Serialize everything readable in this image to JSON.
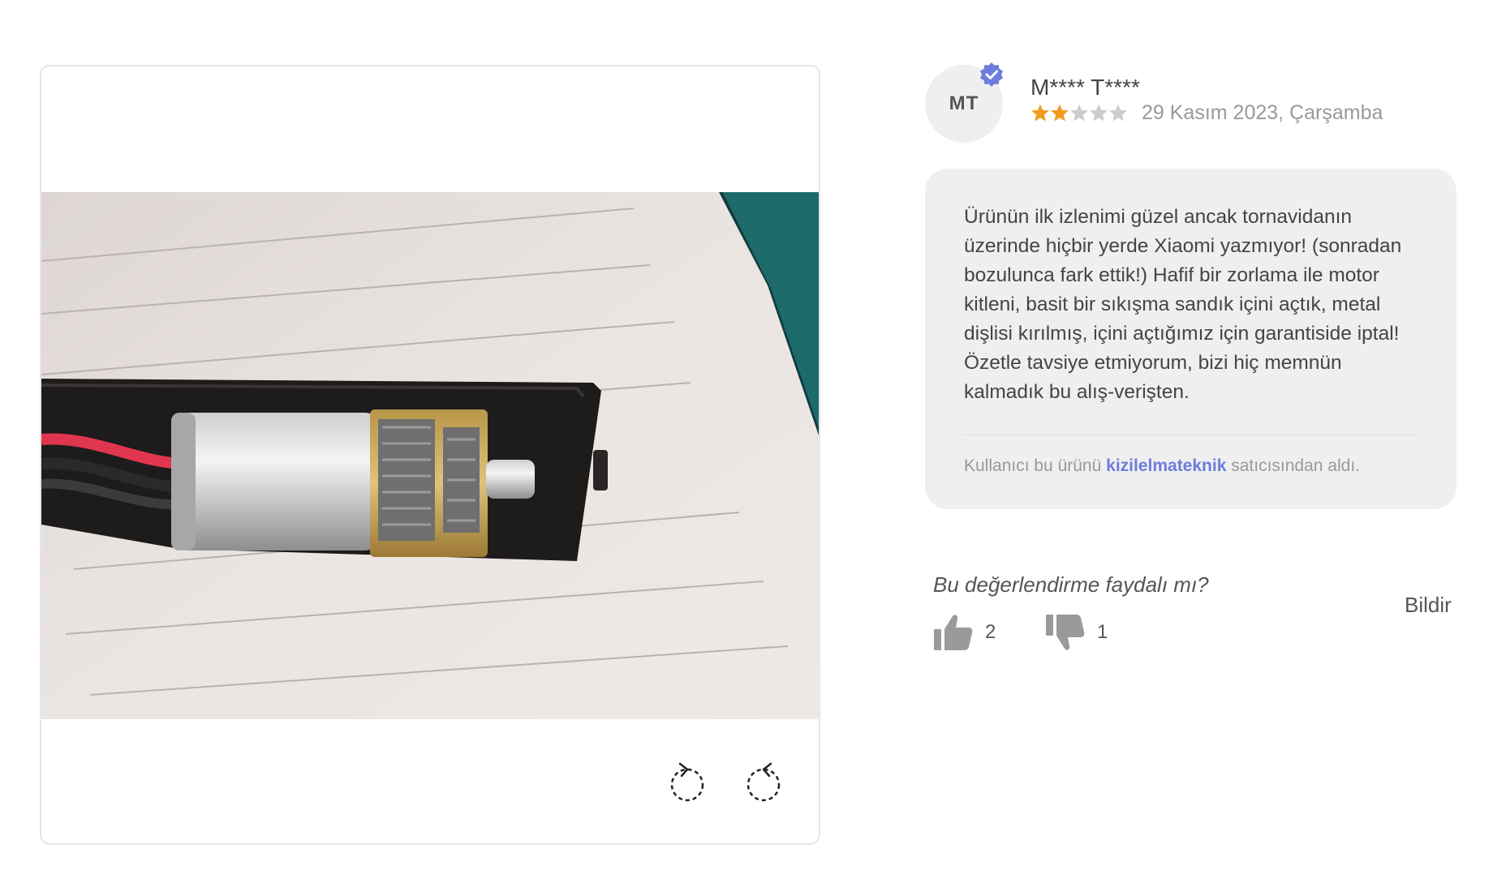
{
  "review": {
    "avatar_initials": "MT",
    "user_name": "M**** T****",
    "rating": 2,
    "rating_max": 5,
    "date": "29 Kasım 2023, Çarşamba",
    "text": "Ürünün ilk izlenimi güzel ancak tornavidanın üzerinde hiçbir yerde Xiaomi yazmıyor! (sonradan bozulunca fark ettik!) Hafif bir zorlama ile motor kitleni, basit bir sıkışma sandık içini açtık, metal dişlisi kırılmış, içini açtığımız için garantiside iptal! Özetle tavsiye etmiyorum, bizi hiç memnün kalmadık bu alış-verişten.",
    "seller_prefix": "Kullanıcı bu ürünü",
    "seller_name": "kizilelmateknik",
    "seller_suffix": "satıcısından aldı."
  },
  "helpful": {
    "question": "Bu değerlendirme faydalı mı?",
    "likes": "2",
    "dislikes": "1",
    "report_label": "Bildir"
  },
  "colors": {
    "star_filled": "#f29c1f",
    "star_empty": "#cccccc",
    "verified_badge": "#6c7ddd",
    "seller_link": "#6c7ddd"
  },
  "icons": {
    "rotate_left": "rotate-left-icon",
    "rotate_right": "rotate-right-icon",
    "thumbs_up": "thumbs-up-icon",
    "thumbs_down": "thumbs-down-icon",
    "verified": "verified-check-icon"
  }
}
